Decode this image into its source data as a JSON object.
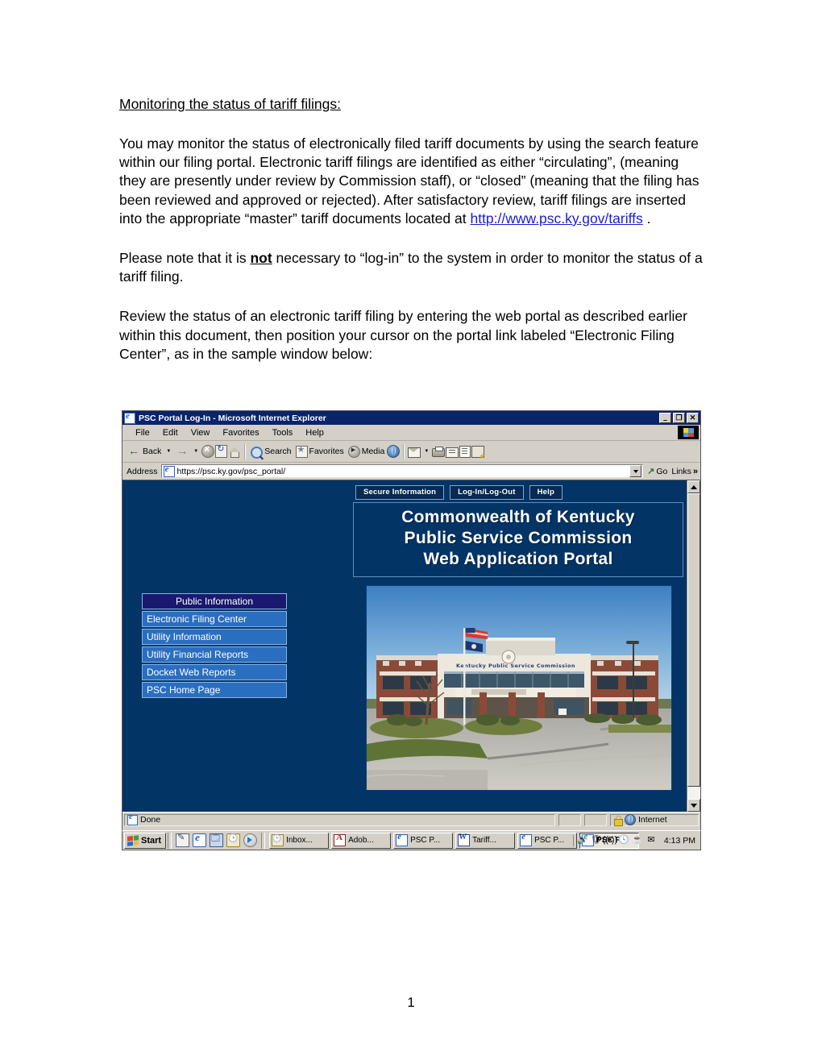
{
  "document": {
    "heading": "Monitoring the status of tariff filings:",
    "paragraph1_before_link": "You may monitor the status of electronically filed tariff documents by using the search feature within our filing portal.  Electronic tariff filings are identified as either “circulating”, (meaning they are presently under review by Commission staff), or “closed” (meaning that the filing has been reviewed and approved or rejected).  After satisfactory review, tariff filings are inserted into the appropriate “master” tariff documents located at ",
    "paragraph1_link": "http://www.psc.ky.gov/tariffs",
    "paragraph1_after_link": " .",
    "paragraph2_part1": "Please note that it is ",
    "paragraph2_emphasis": "not",
    "paragraph2_part2": " necessary to “log-in” to the system in order to monitor the status of a tariff filing.",
    "paragraph3": "Review the status of an electronic tariff filing by entering the web portal as described earlier within this document, then position your cursor on the portal link labeled “Electronic Filing Center”, as in the sample window below:",
    "page_number": "1",
    "link_color": "#1b1bd8"
  },
  "browser": {
    "title": "PSC Portal Log-In - Microsoft Internet Explorer",
    "window_controls": {
      "minimize": "–",
      "restore": "❐",
      "close": "✕"
    },
    "menu": [
      {
        "label": "File"
      },
      {
        "label": "Edit"
      },
      {
        "label": "View"
      },
      {
        "label": "Favorites"
      },
      {
        "label": "Tools"
      },
      {
        "label": "Help"
      }
    ],
    "toolbar": {
      "back_label": "Back",
      "forward_label": "",
      "search_label": "Search",
      "favorites_label": "Favorites",
      "media_label": "Media"
    },
    "address": {
      "label": "Address",
      "value": "https://psc.ky.gov/psc_portal/",
      "go_label": "Go",
      "links_label": "Links",
      "chevron": "»"
    },
    "statusbar": {
      "status": "Done",
      "zone": "Internet"
    }
  },
  "portal": {
    "background_color": "#023466",
    "header_buttons": [
      {
        "label": "Secure Information"
      },
      {
        "label": "Log-In/Log-Out"
      },
      {
        "label": "Help"
      }
    ],
    "title_lines": [
      "Commonwealth of Kentucky",
      "Public Service Commission",
      "Web Application Portal"
    ],
    "nav_items": [
      {
        "label": "Public Information",
        "selected": true
      },
      {
        "label": "Electronic Filing Center",
        "selected": false
      },
      {
        "label": "Utility Information",
        "selected": false
      },
      {
        "label": "Utility Financial Reports",
        "selected": false
      },
      {
        "label": "Docket Web Reports",
        "selected": false
      },
      {
        "label": "PSC Home Page",
        "selected": false
      }
    ],
    "nav_selected_color": "#191970",
    "nav_color": "#2a6ec0",
    "photo_caption": "Kentucky Public Service Commission"
  },
  "taskbar": {
    "start_label": "Start",
    "tasks": [
      {
        "label": "Inbox...",
        "icon": "outlook-icon",
        "active": false
      },
      {
        "label": "Adob...",
        "icon": "adobe-icon",
        "active": false
      },
      {
        "label": "PSC P...",
        "icon": "ie-icon",
        "active": false
      },
      {
        "label": "Tariff...",
        "icon": "word-icon",
        "active": false
      },
      {
        "label": "PSC P...",
        "icon": "ie-icon",
        "active": false
      },
      {
        "label": "PSC P...",
        "icon": "ie-icon",
        "active": true
      }
    ],
    "tray_icons": [
      "🔊",
      "🛡",
      "((•))",
      "🕓",
      "☕",
      "✉"
    ],
    "time": "4:13 PM"
  }
}
